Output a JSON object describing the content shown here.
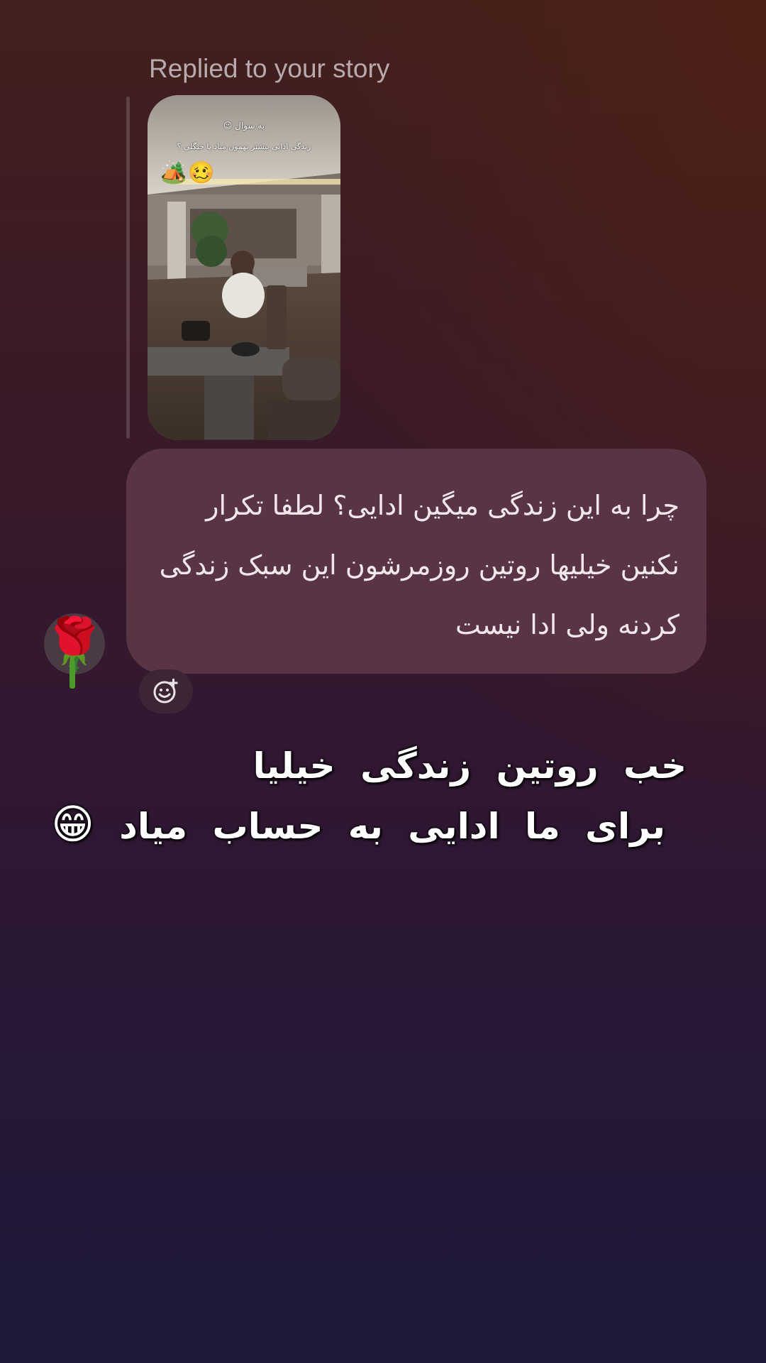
{
  "replied_label": "Replied to your story",
  "story": {
    "question_line1": "به سوال 😉",
    "question_line2": "زندگی ادایی بیشتر بهمون میاد یا جنگلی ؟",
    "emojis": "🏕️🥴"
  },
  "message": {
    "text": "چرا به این زندگی میگین ادایی؟ لطفا تکرار نکنین خیلیها روتین روزمرشون این سبک زندگی کردنه ولی ادا نیست",
    "reaction_icon": "add-reaction-icon"
  },
  "sender_avatar": {
    "emoji": "🌹"
  },
  "story_overlay_text": {
    "line1": "خب روتین زندگی خیلیا",
    "line2": "برای ما ادایی به حساب میاد",
    "emoji": "😁"
  }
}
